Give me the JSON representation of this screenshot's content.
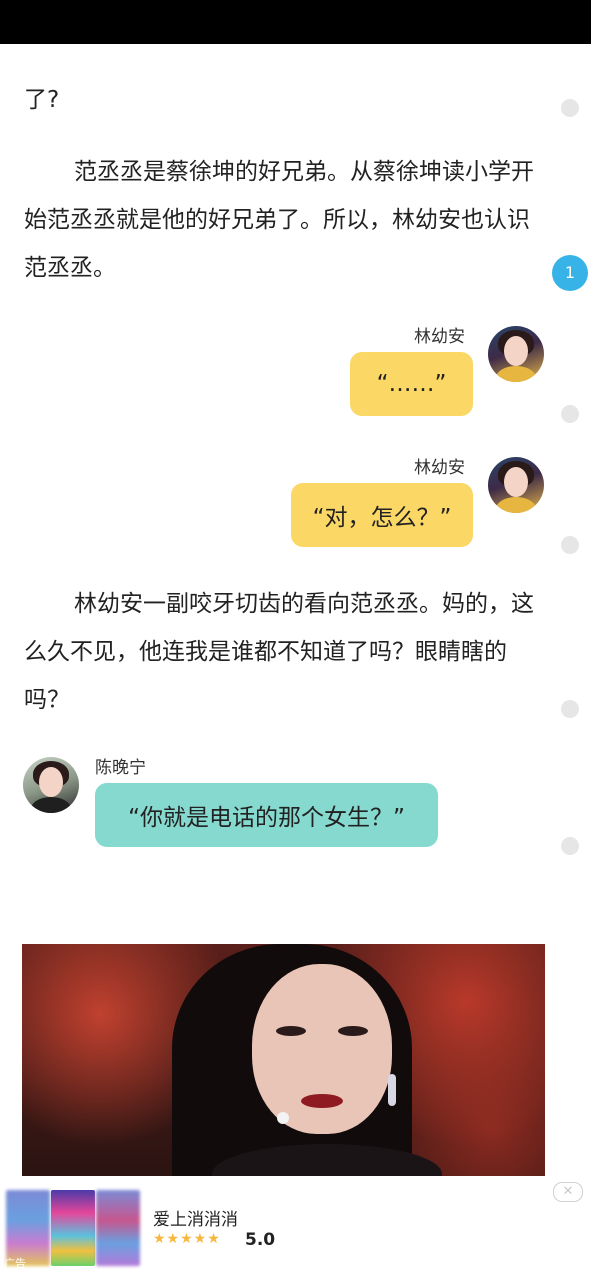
{
  "paragraphs": {
    "p0": "了?",
    "p1": "范丞丞是蔡徐坤的好兄弟。从蔡徐坤读小学开始范丞丞就是他的好兄弟了。所以，林幼安也认识范丞丞。",
    "p2": "林幼安一副咬牙切齿的看向范丞丞。妈的，这么久不见，他连我是谁都不知道了吗？眼睛瞎的吗？"
  },
  "chat": [
    {
      "speaker": "林幼安",
      "text": "“……”",
      "side": "right",
      "color": "#fbd766"
    },
    {
      "speaker": "林幼安",
      "text": "“对，怎么？”",
      "side": "right",
      "color": "#fbd766"
    },
    {
      "speaker": "陈晚宁",
      "text": "“你就是电话的那个女生？”",
      "side": "left",
      "color": "#86d9cf"
    }
  ],
  "side_badge": "1",
  "ad": {
    "tag": "广告",
    "title": "爱上消消消",
    "stars": "★★★★★",
    "rating": "5.0",
    "close_icon": "close-icon"
  },
  "colors": {
    "badge": "#37b3e8",
    "yellow_bubble": "#fbd766",
    "teal_bubble": "#86d9cf",
    "star": "#f6b73c"
  }
}
